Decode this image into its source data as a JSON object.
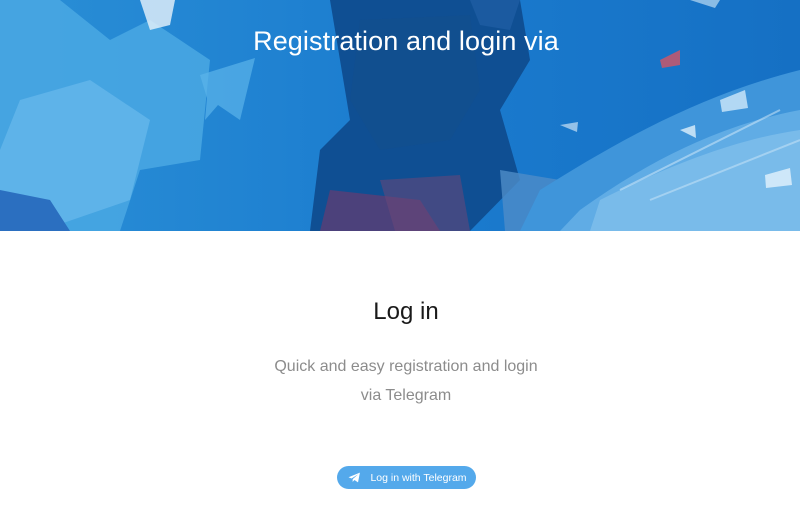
{
  "hero": {
    "title": "Registration and login via"
  },
  "login": {
    "heading": "Log in",
    "description_line1": "Quick and easy registration and login",
    "description_line2": "via Telegram"
  },
  "telegram_button": {
    "label": "Log in with Telegram",
    "icon": "telegram-plane-icon",
    "color": "#54a9eb"
  },
  "colors": {
    "hero_blue": "#1a7fd0",
    "text_gray": "#8c8c8c"
  }
}
